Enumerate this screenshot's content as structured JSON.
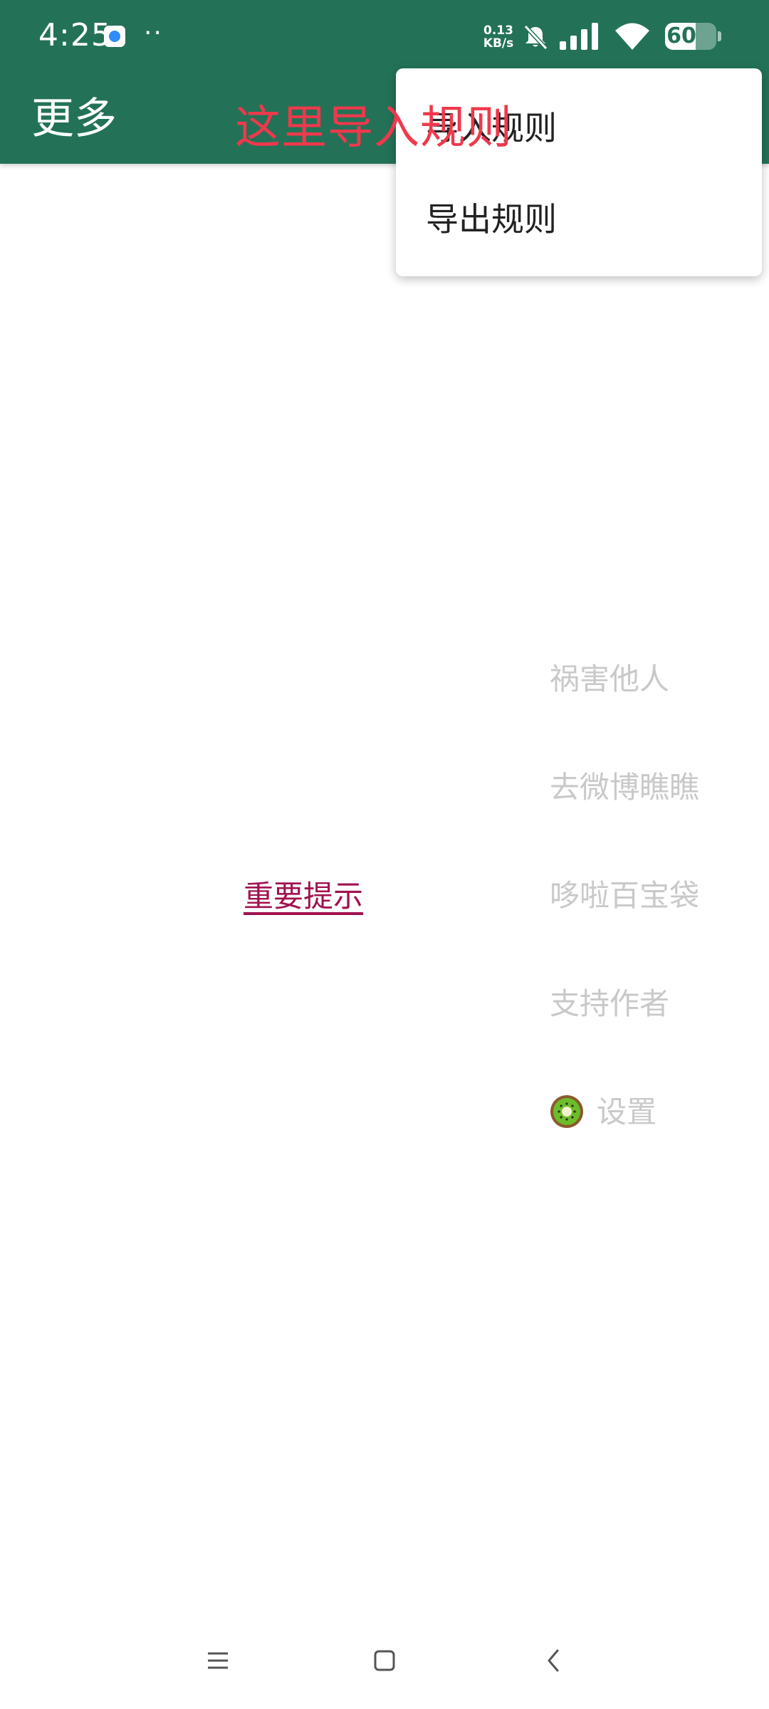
{
  "status_bar": {
    "time": "4:25",
    "dots": "··",
    "net_speed_value": "0.13",
    "net_speed_unit": "KB/s",
    "battery_level": "60",
    "battery_fraction": 0.6
  },
  "header": {
    "title": "更多",
    "background_color": "#237257"
  },
  "annotation": {
    "text": "这里导入规则",
    "color": "#f0384c"
  },
  "menu": {
    "items": [
      {
        "label": "导入规则"
      },
      {
        "label": "导出规则"
      }
    ]
  },
  "main": {
    "notice_link": "重要提示",
    "side_items": [
      {
        "label": "祸害他人"
      },
      {
        "label": "去微博瞧瞧"
      },
      {
        "label": "哆啦百宝袋"
      },
      {
        "label": "支持作者"
      },
      {
        "label": "设置",
        "icon": "kiwi-icon"
      }
    ]
  },
  "nav_bar": {
    "icons": [
      "menu-icon",
      "home-icon",
      "back-icon"
    ]
  }
}
